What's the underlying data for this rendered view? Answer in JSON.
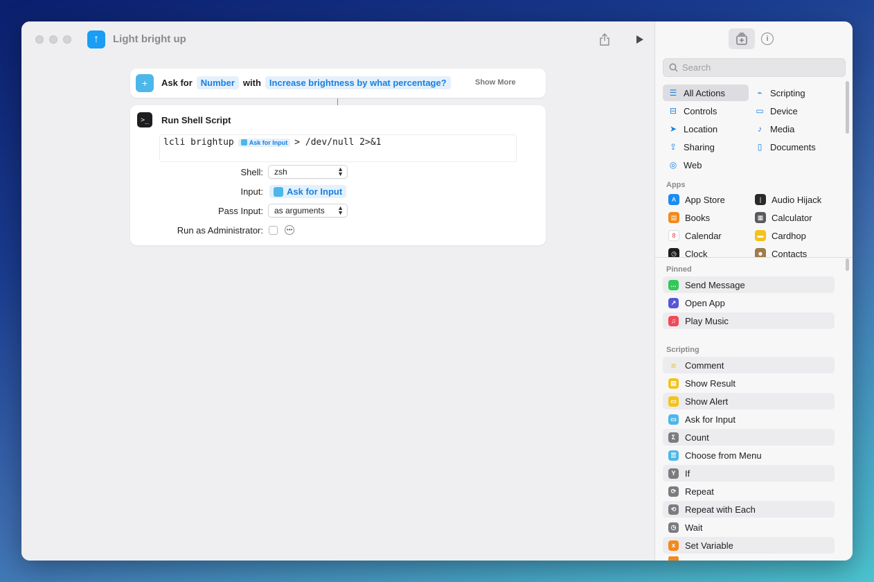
{
  "window": {
    "title": "Light bright up",
    "app_icon": "arrow-up-icon"
  },
  "actions": {
    "ask": {
      "label_ask_for": "Ask for",
      "type_token": "Number",
      "label_with": "with",
      "prompt_token": "Increase brightness by what percentage?",
      "show_more": "Show More"
    },
    "shell": {
      "title": "Run Shell Script",
      "script_prefix": "lcli brightup",
      "script_var": "Ask for Input",
      "script_suffix": "> /dev/null 2>&1",
      "shell_label": "Shell:",
      "shell_value": "zsh",
      "input_label": "Input:",
      "input_value": "Ask for Input",
      "pass_input_label": "Pass Input:",
      "pass_input_value": "as arguments",
      "run_as_admin_label": "Run as Administrator:"
    }
  },
  "sidebar": {
    "search_placeholder": "Search",
    "categories": [
      {
        "label": "All Actions",
        "icon": "list-icon"
      },
      {
        "label": "Scripting",
        "icon": "scripting-icon"
      },
      {
        "label": "Controls",
        "icon": "controls-icon"
      },
      {
        "label": "Device",
        "icon": "device-icon"
      },
      {
        "label": "Location",
        "icon": "location-icon"
      },
      {
        "label": "Media",
        "icon": "music-note-icon"
      },
      {
        "label": "Sharing",
        "icon": "share-icon"
      },
      {
        "label": "Documents",
        "icon": "document-icon"
      },
      {
        "label": "Web",
        "icon": "compass-icon"
      }
    ],
    "apps_header": "Apps",
    "apps": [
      {
        "label": "App Store",
        "color": "#1a8cf0"
      },
      {
        "label": "Audio Hijack",
        "color": "#2a2a2a"
      },
      {
        "label": "Books",
        "color": "#f28a1a"
      },
      {
        "label": "Calculator",
        "color": "#5a5a5e"
      },
      {
        "label": "Calendar",
        "color": "#ffffff"
      },
      {
        "label": "Cardhop",
        "color": "#f4c21a"
      },
      {
        "label": "Clock",
        "color": "#1d1d1f"
      },
      {
        "label": "Contacts",
        "color": "#a07a4a"
      }
    ],
    "pinned_header": "Pinned",
    "pinned": [
      {
        "label": "Send Message",
        "color": "#34c759"
      },
      {
        "label": "Open App",
        "color": "#5856d6"
      },
      {
        "label": "Play Music",
        "color": "#f2485a"
      }
    ],
    "scripting_header": "Scripting",
    "scripting": [
      {
        "label": "Comment",
        "color": "#f5d65a"
      },
      {
        "label": "Show Result",
        "color": "#f5c21a"
      },
      {
        "label": "Show Alert",
        "color": "#f5c21a"
      },
      {
        "label": "Ask for Input",
        "color": "#4db7ea"
      },
      {
        "label": "Count",
        "color": "#7c7c80"
      },
      {
        "label": "Choose from Menu",
        "color": "#4db7ea"
      },
      {
        "label": "If",
        "color": "#7c7c80"
      },
      {
        "label": "Repeat",
        "color": "#7c7c80"
      },
      {
        "label": "Repeat with Each",
        "color": "#7c7c80"
      },
      {
        "label": "Wait",
        "color": "#7c7c80"
      },
      {
        "label": "Set Variable",
        "color": "#f5891a"
      }
    ]
  }
}
